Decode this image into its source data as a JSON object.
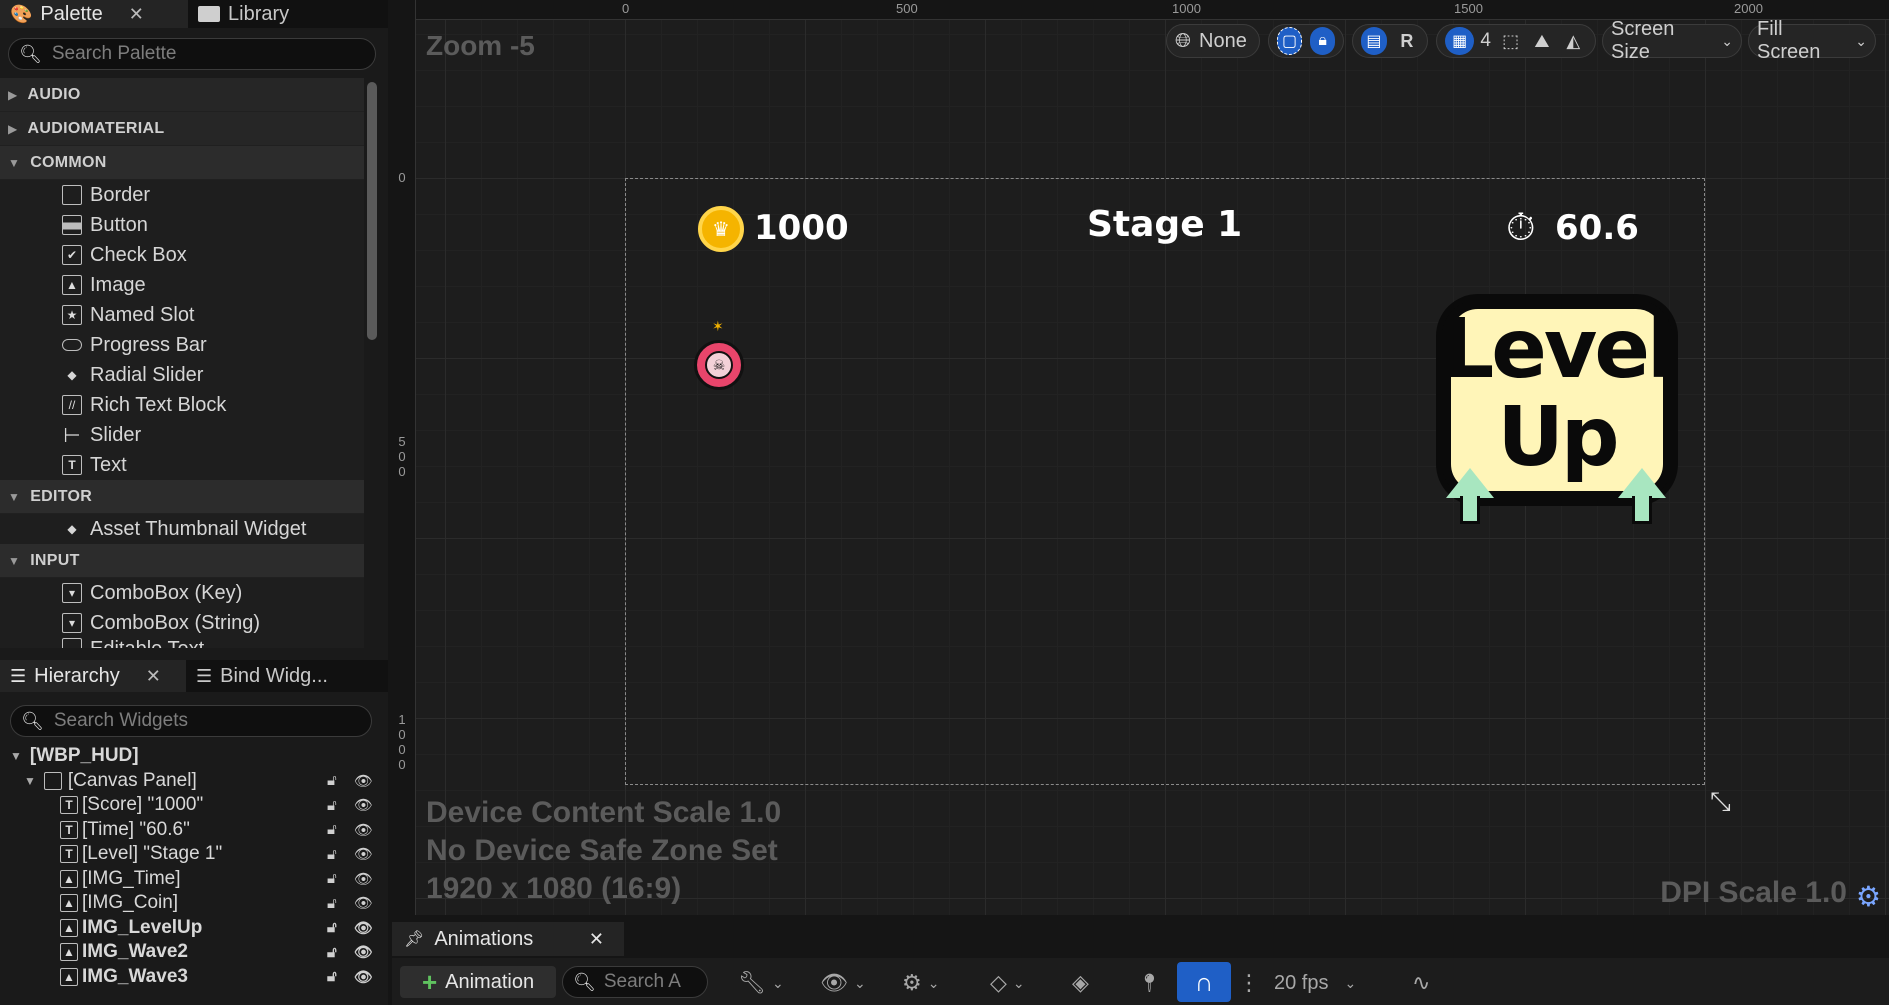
{
  "palette": {
    "tabs": [
      {
        "label": "Palette"
      },
      {
        "label": "Library"
      }
    ],
    "search_placeholder": "Search Palette",
    "categories": {
      "audio": "AUDIO",
      "audiomaterial": "AUDIOMATERIAL",
      "common": "COMMON",
      "editor": "EDITOR",
      "input": "INPUT"
    },
    "common_items": [
      "Border",
      "Button",
      "Check Box",
      "Image",
      "Named Slot",
      "Progress Bar",
      "Radial Slider",
      "Rich Text Block",
      "Slider",
      "Text"
    ],
    "editor_items": [
      "Asset Thumbnail Widget"
    ],
    "input_items": [
      "ComboBox (Key)",
      "ComboBox (String)",
      "Editable Text"
    ]
  },
  "hierarchy": {
    "tabs": [
      {
        "label": "Hierarchy"
      },
      {
        "label": "Bind Widg..."
      }
    ],
    "search_placeholder": "Search Widgets",
    "root": "[WBP_HUD]",
    "canvas": "[Canvas Panel]",
    "children": [
      {
        "label": "[Score] \"1000\"",
        "bold": false
      },
      {
        "label": "[Time] \"60.6\"",
        "bold": false
      },
      {
        "label": "[Level] \"Stage 1\"",
        "bold": false
      },
      {
        "label": "[IMG_Time]",
        "bold": false
      },
      {
        "label": "[IMG_Coin]",
        "bold": false
      },
      {
        "label": "IMG_LevelUp",
        "bold": true
      },
      {
        "label": "IMG_Wave2",
        "bold": true
      },
      {
        "label": "IMG_Wave3",
        "bold": true
      }
    ]
  },
  "designer": {
    "ruler_top": [
      "0",
      "500",
      "1000",
      "1500",
      "2000"
    ],
    "ruler_left": [
      "0",
      "5\n0\n0",
      "1\n0\n0\n0"
    ],
    "zoom": "Zoom -5",
    "toolbar": {
      "world_label": "None",
      "r_label": "R",
      "grid_value": "4",
      "screen_size": "Screen Size",
      "fill_screen": "Fill Screen"
    },
    "device_lines": [
      "Device Content Scale 1.0",
      "No Device Safe Zone Set",
      "1920 x 1080 (16:9)"
    ],
    "dpi": "DPI Scale 1.0",
    "hud": {
      "score": "1000",
      "stage": "Stage 1",
      "time": "60.6",
      "level_up_line1": "Level",
      "level_up_line2": "Up"
    }
  },
  "animations": {
    "tab_label": "Animations",
    "add_label": "Animation",
    "search_placeholder": "Search A",
    "fps": "20 fps"
  },
  "colors": {
    "accent": "#1f5fc6",
    "coin": "#f5b400",
    "arrow": "#a8e6c0",
    "levelup_fill": "#fff5b8"
  }
}
